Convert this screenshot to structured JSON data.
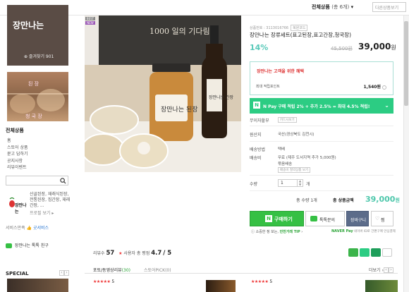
{
  "topbar": {
    "menu_label": "전체상품",
    "menu_count": "(총 6개)",
    "menu_arrow": "▾",
    "search_placeholder": "다른상품보기"
  },
  "store": {
    "name": "장만나는",
    "fav_label": "즐겨찾기 901",
    "banner_top": "된 장",
    "banner_bottom": "청 국 장"
  },
  "sidebar": {
    "category_title": "전체상품",
    "categories": [
      "홈",
      "스토어 상품",
      "묻고 답하기",
      "공지사항",
      "리뷰이벤트"
    ],
    "promo_logo": "장만나는",
    "promo_text": "산골된장, 재래식된장, 전통된장, 집간장, 재래간장, ...",
    "promo_more": "프로필 보기 ▸",
    "svc_label": "서비스만족",
    "svc_value": "굿서비스",
    "talk_label": "장만나는 톡톡 친구",
    "special_title": "SPECIAL",
    "arrow_prev": "‹",
    "arrow_next": "›"
  },
  "product": {
    "badge_best": "BEST",
    "badge_new": "NEW",
    "code_label": "상품번호 : 3113016766",
    "code_tag": "복원코드",
    "title": "장만나는 장류세트(표고된장,표고간장,청국장)",
    "discount": "14%",
    "original_price": "45,500원",
    "price": "39,000",
    "price_unit": "원",
    "jar_label_1": "장만나는 된장",
    "jar_label_2": "장만나는 간장",
    "photo_sign": "1000 일의 기다림"
  },
  "benefit": {
    "title": "장만나는 고객을 위한 혜택",
    "line_label": "최대 적립포인트",
    "line_value": "1,540원"
  },
  "npay_bar": {
    "n": "N",
    "text": "N Pay 구매 적립 2% + 추가 2.5% = 최대 4.5% 적립!",
    "chevron": "⌄"
  },
  "rows": {
    "interest_free_label": "무이자할부",
    "interest_free_chip": "카드사보기",
    "origin_label": "원산지",
    "origin_value": "국산(경상북도 김천시)",
    "shipping_method_label": "배송방법",
    "shipping_method_value": "택배",
    "shipping_fee_label": "배송비",
    "shipping_fee_value": "무료 (제주 도서지역 추가 5,000원)",
    "shipping_fee_extra": "묶음배송",
    "shipping_fee_chip": "배송비 절약상품 보기",
    "qty_label": "수량",
    "qty_value": "1",
    "qty_up": "▲",
    "qty_down": "▼",
    "qty_unit": "개"
  },
  "total": {
    "qty_text": "총 수량 1개",
    "label": "총 상품금액",
    "amount": "39,000",
    "unit": "원"
  },
  "buttons": {
    "buy_n": "N",
    "buy": "구매하기",
    "talk": "톡톡문의",
    "cart": "장바구니",
    "wish": "찜"
  },
  "tip": {
    "prefix": "ⓘ 소중한 정 보는, ",
    "highlight": "안전거래 TIP",
    "suffix": " ›",
    "npay_brand": "NAVER Pay",
    "npay_text": " 네이버 ID로 간편구매 안심결제"
  },
  "review_summary": {
    "review_label": "리뷰수",
    "review_count": "57",
    "rating_label": "사용자 총 평점",
    "rating": "4.7",
    "rating_max": "/ 5"
  },
  "reviews": {
    "tab_title": "포토/동영상리뷰",
    "tab_count": "(30)",
    "tab_2": "스토어PICK(0)",
    "more": "더보기 ›",
    "card1_stars": "★★★★★",
    "card1_score": "5",
    "card2_stars": "★★★★★",
    "card2_score": "5"
  },
  "colors": {
    "accent": "#2ccc83",
    "discount": "#58c9b9",
    "buy": "#36c044",
    "cart": "#5c6c8a",
    "store_bg": "#5a4c45"
  }
}
